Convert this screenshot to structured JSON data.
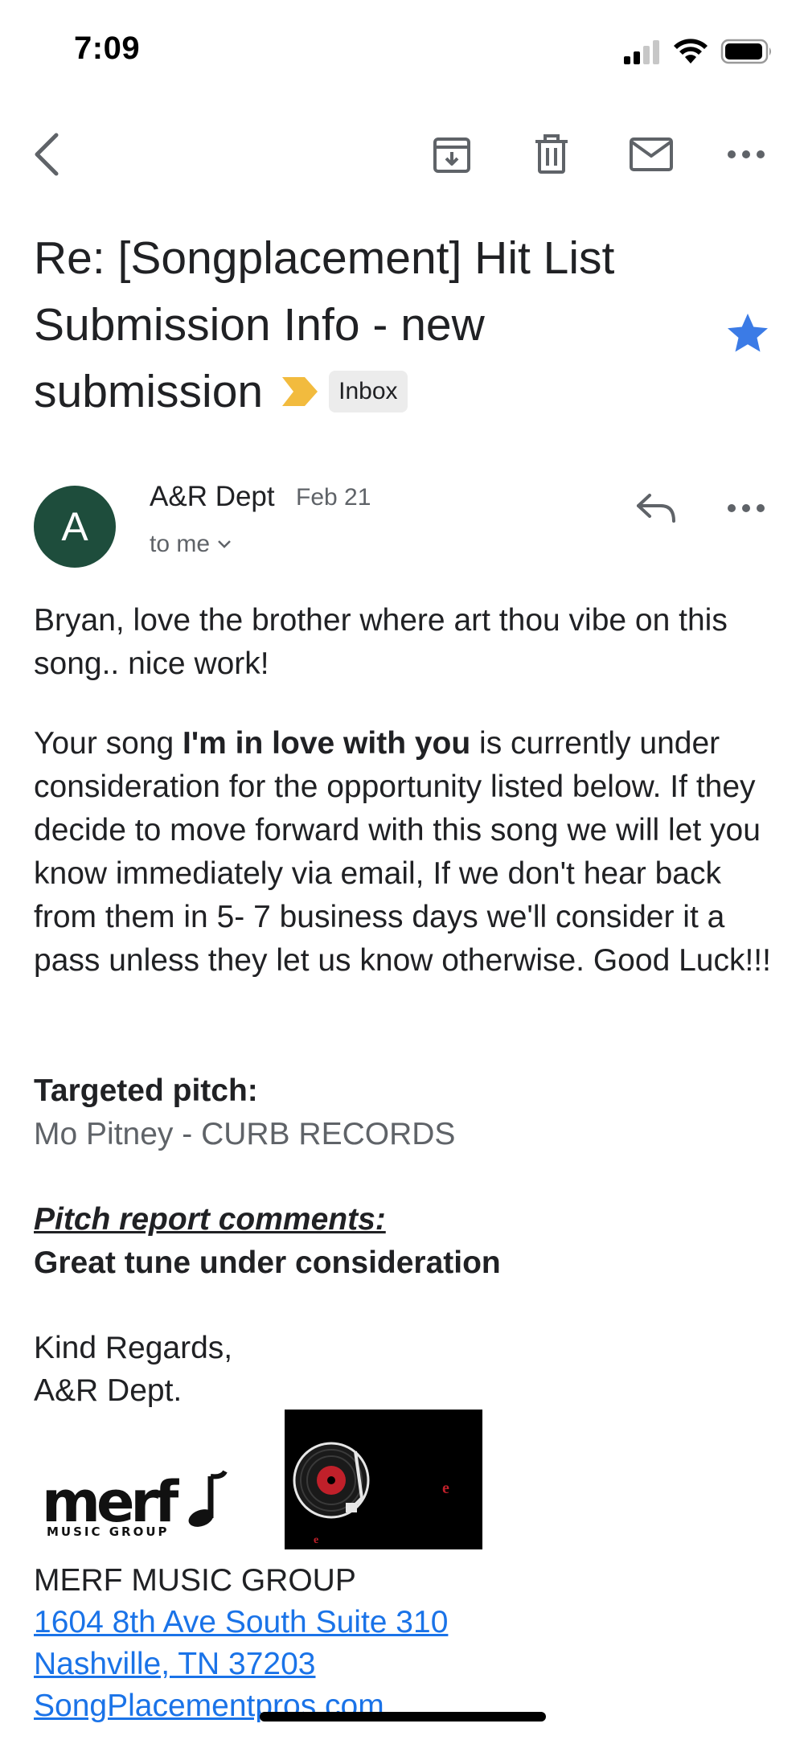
{
  "status_bar": {
    "time": "7:09"
  },
  "email": {
    "subject": "Re: [Songplacement] Hit List Submission Info - new submission",
    "label": "Inbox",
    "sender": {
      "initial": "A",
      "name": "A&R Dept",
      "date": "Feb 21",
      "recipient": "to me"
    },
    "body": {
      "intro": "Bryan, love the brother where art thou vibe on this song.. nice work!",
      "p1_prefix": "Your song ",
      "song_title": "I'm in love with you",
      "p1_suffix": " is currently under consideration for the opportunity listed below. If they decide to move forward with this song we will let you know immediately via email, If we don't hear back from them in 5- 7 business days we'll consider it a pass unless they let us know otherwise. Good Luck!!!",
      "targeted_label": "Targeted pitch:",
      "targeted_value": "Mo Pitney - CURB RECORDS",
      "comments_label": "Pitch report comments:",
      "comments_value": "Great tune under consideration",
      "regards": "Kind Regards,",
      "signature": "A&R Dept."
    },
    "footer": {
      "logo_word": "merf",
      "logo_sub": "MUSIC GROUP",
      "company": "MERF MUSIC GROUP",
      "address1": "1604 8th Ave South Suite 310 ",
      "address2": "Nashville, TN 37203",
      "website": "SongPlacementpros.com"
    }
  },
  "colors": {
    "avatar": "#1e4d3c",
    "star": "#3b7be6",
    "importance": "#f2bb3e",
    "link": "#1a73e8"
  }
}
